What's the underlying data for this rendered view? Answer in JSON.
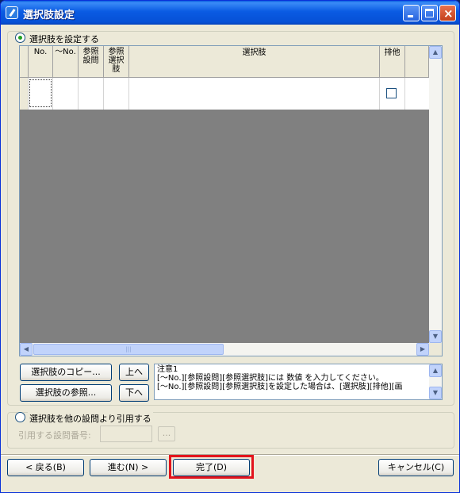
{
  "window": {
    "title": "選択肢設定",
    "close_glyph": "×"
  },
  "options_group": {
    "radio_label": "選択肢を設定する",
    "selected": true,
    "columns": [
      "No.",
      "〜No.",
      "参照\n設問",
      "参照\n選択\n肢",
      "選択肢",
      "排他"
    ],
    "row": {
      "exclusive_checked": false
    }
  },
  "buttons": {
    "copy": "選択肢のコピー...",
    "up": "上へ",
    "ref": "選択肢の参照...",
    "down": "下へ"
  },
  "note": {
    "title": "注意1",
    "line1": "[〜No.][参照設問][参照選択肢]には 数値 を入力してください。",
    "line2": "[〜No.][参照設問][参照選択肢]を設定した場合は、[選択肢][排他][画"
  },
  "cite_group": {
    "radio_label": "選択肢を他の設問より引用する",
    "selected": false,
    "field_label": "引用する設問番号:",
    "field_value": "",
    "browse": "..."
  },
  "footer": {
    "back": "< 戻る(B)",
    "next": "進む(N) >",
    "finish": "完了(D)",
    "cancel": "キャンセル(C)"
  },
  "icons": {
    "window": "app-icon",
    "minimize": "minimize-icon",
    "maximize": "maximize-icon",
    "close": "close-icon"
  },
  "colors": {
    "titlebar": "#0a5be3",
    "face": "#ece9d8",
    "grid_empty": "#808080",
    "highlight": "#e3141c"
  }
}
